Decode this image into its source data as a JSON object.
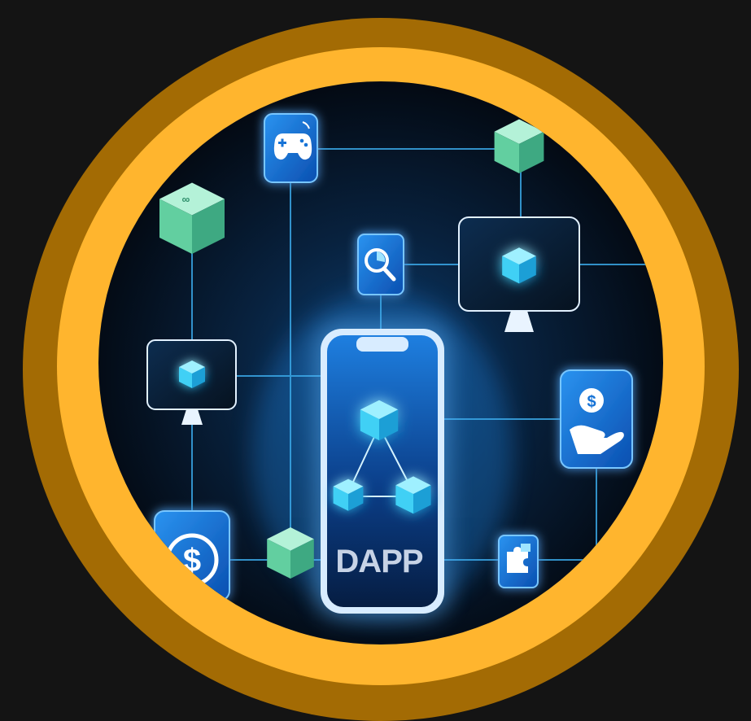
{
  "illustration": {
    "center_label": "DAPP",
    "icons": [
      "gamepad-icon",
      "analytics-search-icon",
      "dollar-coin-icon",
      "dollar-hand-icon",
      "puzzle-icon",
      "blockchain-block-icon",
      "monitor-icon",
      "smartphone-icon"
    ]
  },
  "colors": {
    "background": "#141414",
    "ring_outer": "#a36b04",
    "ring_inner": "#ffb52e",
    "scene_dark": "#050c17",
    "glow": "#37b8ff",
    "panel_blue": "#1673d6",
    "cube_green": "#7fe0b8",
    "cube_cyan": "#39c8f5",
    "line": "#3aa7e6"
  }
}
